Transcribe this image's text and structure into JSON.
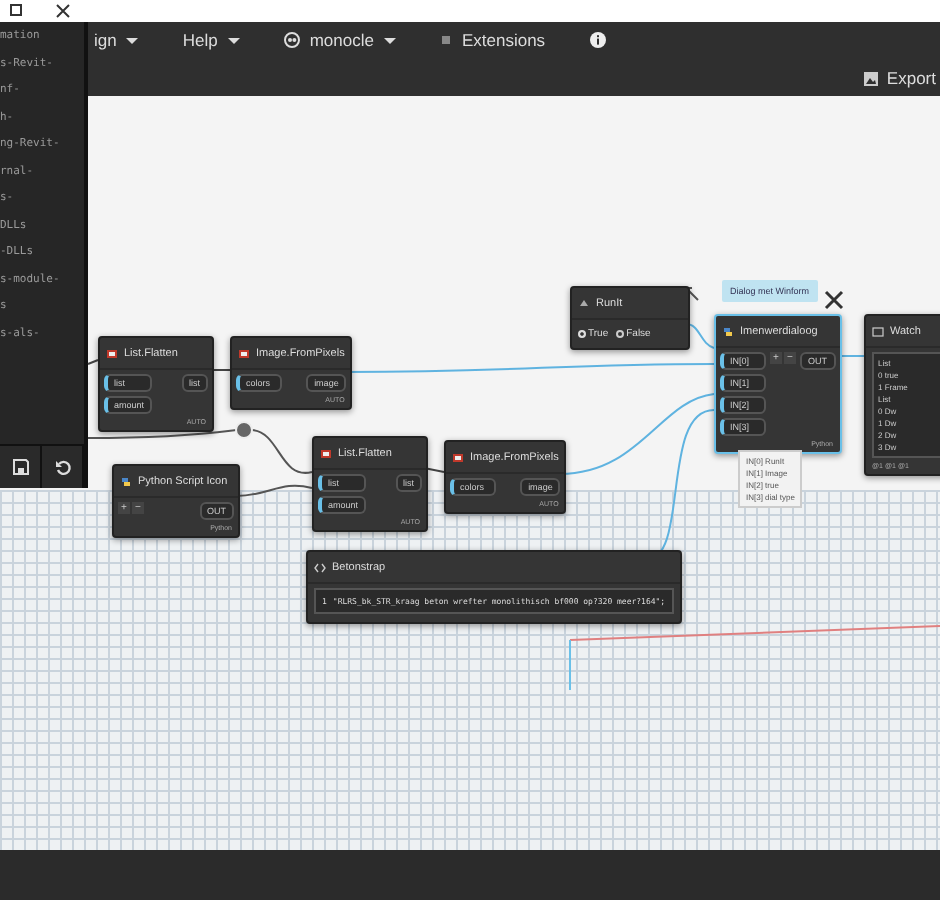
{
  "menu": [
    {
      "label": "ign"
    },
    {
      "label": "Help"
    },
    {
      "label": "monocle"
    }
  ],
  "extensions": "Extensions",
  "export": "Export",
  "code_lines": [
    "mation",
    "s-Revit-",
    "nf-",
    "h-",
    "ng-Revit-",
    "rnal-",
    "s-",
    "DLLs",
    "-DLLs",
    "s-module-",
    "s",
    "s-als-"
  ],
  "nodes": [
    {
      "kind": "function",
      "title": "List.Flatten",
      "inputs": [
        "list",
        "amount"
      ],
      "outputs": [
        "list"
      ],
      "footer": "AUTO",
      "selected": false
    },
    {
      "kind": "function",
      "title": "Image.FromPixels",
      "inputs": [
        "colors"
      ],
      "outputs": [
        "image"
      ],
      "footer": "AUTO",
      "selected": false
    },
    {
      "kind": "python",
      "title": "Python Script Icon",
      "buttons": [
        "+",
        "−"
      ],
      "outputs": [
        "OUT"
      ],
      "footer": "Python",
      "selected": false
    },
    {
      "kind": "function",
      "title": "List.Flatten",
      "inputs": [
        "list",
        "amount"
      ],
      "outputs": [
        "list"
      ],
      "footer": "AUTO",
      "selected": false
    },
    {
      "kind": "function",
      "title": "Image.FromPixels",
      "inputs": [
        "colors"
      ],
      "outputs": [
        "image"
      ],
      "footer": "AUTO",
      "selected": false
    },
    {
      "kind": "toggle",
      "title": "RunIt",
      "options": [
        {
          "label": "True",
          "selected": true
        },
        {
          "label": "False",
          "selected": false
        }
      ]
    },
    {
      "kind": "python",
      "title": "Imenwerdialoog",
      "inputs": [
        "IN[0]",
        "IN[1]",
        "IN[2]",
        "IN[3]"
      ],
      "buttons": [
        "+",
        "−"
      ],
      "outputs": [
        "OUT"
      ],
      "footer": "Python",
      "selected": true
    },
    {
      "kind": "watch",
      "title": "Watch",
      "items": [
        "List",
        "0 true",
        "1 Frame",
        "List",
        "0 Dw",
        "1 Dw",
        "2 Dw",
        "3 Dw"
      ],
      "footer": "@1 @1 @1"
    },
    {
      "kind": "code",
      "title": "Betonstrap",
      "line": "1",
      "code": "\"RLRS_bk_STR_kraag beton wrefter monolithisch bf000 op?320 meer?164\";"
    }
  ],
  "note": "Dialog met Winform",
  "tooltip": [
    "IN[0] RunIt",
    "IN[1] Image",
    "IN[2] true",
    "IN[3] dial type"
  ]
}
